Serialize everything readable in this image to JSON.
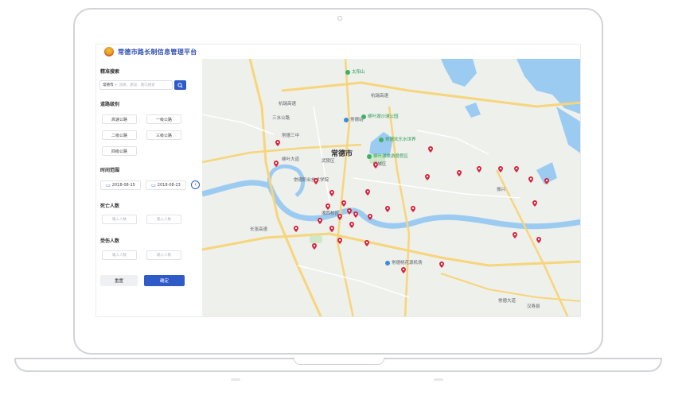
{
  "app": {
    "title": "常德市路长制信息管理平台"
  },
  "search": {
    "title": "精准搜索",
    "city": "常德市",
    "placeholder": "道路、路段、路口搜索"
  },
  "road_level": {
    "title": "道路级别",
    "items": [
      "高速公路",
      "一级公路",
      "二级公路",
      "三级公路",
      "四级公路"
    ]
  },
  "time_range": {
    "title": "时间范围",
    "start": "2018-08-15",
    "end": "2018-08-23"
  },
  "deaths": {
    "title": "死亡人数",
    "min_placeholder": "输入人数",
    "max_placeholder": "输入人数"
  },
  "injuries": {
    "title": "受伤人数",
    "min_placeholder": "输入人数",
    "max_placeholder": "输入人数"
  },
  "actions": {
    "reset": "重置",
    "confirm": "确定"
  },
  "map": {
    "labels": {
      "city": "常德市",
      "district_wuling": "武陵区",
      "district_dingcheng": "鼎城区",
      "hanshou": "汉寿县",
      "expressway_a": "杭瑞高速",
      "expressway_b": "杭瑞高速",
      "expressway_c": "长张高速",
      "road_liuye": "柳叶大道",
      "road_changde": "常德大道",
      "sanzhong": "常德三中",
      "station": "常德站",
      "airport": "常德桃花源机场",
      "taiyangshan": "太阳山",
      "liuyehu_park": "柳叶湖沙滩公园",
      "happy_world": "常德欢乐水世界",
      "liuye_scenic": "柳叶湖旅游度假区",
      "zhenxing": "振兴",
      "tech_school": "常德职业技术学院",
      "medical_school": "湘西校区",
      "road_sanshui": "三水公路"
    },
    "pin_color": "#d7263d",
    "water_color": "#9ccbf2",
    "road_color": "#f7d57a"
  }
}
